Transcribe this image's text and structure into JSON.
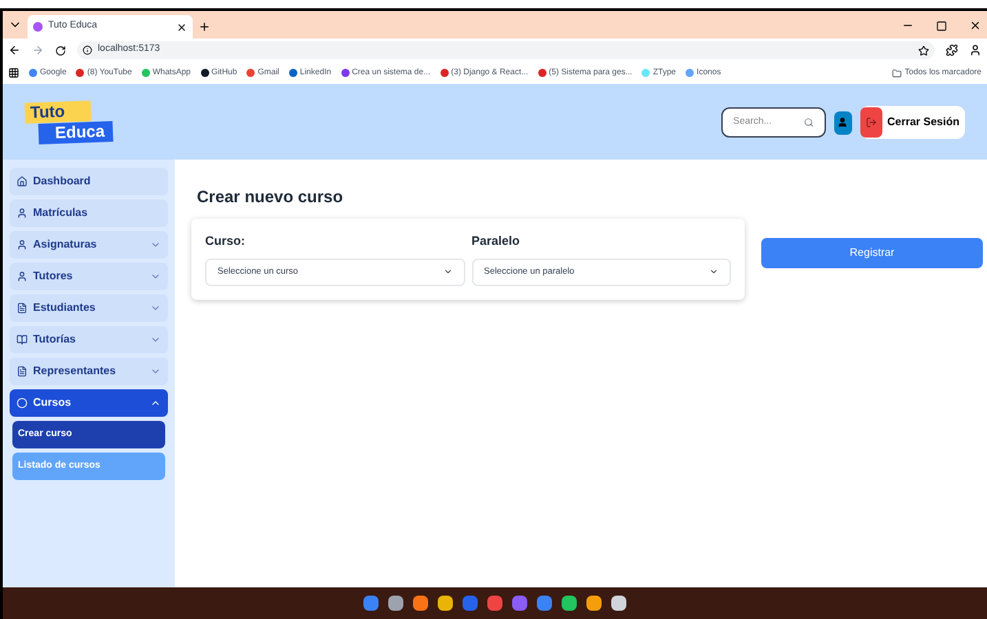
{
  "browser": {
    "tab_title": "Tuto Educa",
    "url": "localhost:5173",
    "bookmarks": [
      "Google",
      "(8) YouTube",
      "WhatsApp",
      "GitHub",
      "Gmail",
      "LinkedIn",
      "Crea un sistema de...",
      "(3) Django & React...",
      "(5) Sistema para ges...",
      "ZType",
      "Iconos"
    ],
    "all_bookmarks": "Todos los marcadore"
  },
  "header": {
    "logo_top": "Tuto",
    "logo_bottom": "Educa",
    "search": {
      "placeholder": "Search..."
    },
    "logout": "Cerrar Sesión"
  },
  "sidebar": {
    "items": [
      {
        "label": "Dashboard",
        "selected": false
      },
      {
        "label": "Matrículas",
        "selected": false
      },
      {
        "label": "Asignaturas",
        "selected": false,
        "expanded": false
      },
      {
        "label": "Tutores",
        "selected": false,
        "expanded": false
      },
      {
        "label": "Estudiantes",
        "selected": false,
        "expanded": false
      },
      {
        "label": "Tutorías",
        "selected": false,
        "expanded": false
      },
      {
        "label": "Representantes",
        "selected": false,
        "expanded": false
      },
      {
        "label": "Cursos",
        "selected": true,
        "expanded": true,
        "children": [
          {
            "label": "Crear curso",
            "selected": true
          },
          {
            "label": "Listado de cursos",
            "selected": false
          }
        ]
      }
    ]
  },
  "main": {
    "title": "Crear nuevo curso",
    "fields": [
      {
        "label": "Curso:",
        "placeholder": "Seleccione un curso"
      },
      {
        "label": "Paralelo",
        "placeholder": "Seleccione un paralelo"
      }
    ],
    "submit": "Registrar"
  }
}
